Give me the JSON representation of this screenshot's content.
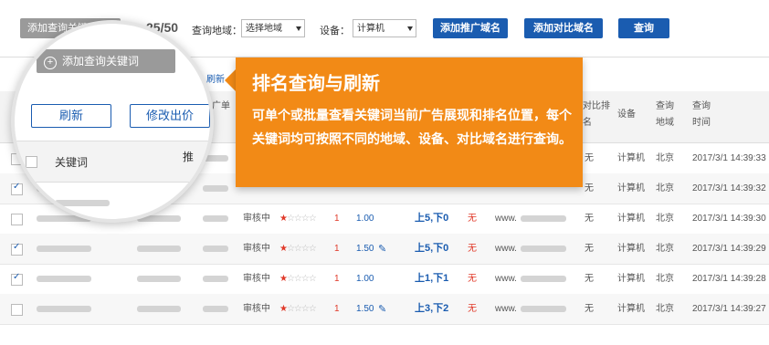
{
  "toolbar": {
    "add_keyword_label": "添加查询关键词",
    "counter": "25/50",
    "region_label": "查询地域：",
    "region_value": "选择地域",
    "device_label": "设备：",
    "device_value": "计算机",
    "add_promo_domain": "添加推广域名",
    "add_compare_domain": "添加对比域名",
    "query_button": "查询"
  },
  "magnifier": {
    "add_keyword_label": "添加查询关键词",
    "refresh_button": "刷新",
    "modify_bid_button": "修改出价",
    "col_keyword": "关键词",
    "col_promo": "推",
    "partial_button": "刷新"
  },
  "callout": {
    "title": "排名查询与刷新",
    "text": "可单个或批量查看关键词当前广告展现和排名位置，每个关键词均可按照不同的地域、设备、对比域名进行查询。"
  },
  "table": {
    "headers": {
      "promo_unit": "推广单元",
      "compare_rank": "对比排名",
      "device": "设备",
      "query_region": "查询地域",
      "query_time": "查询时间"
    },
    "rows": [
      {
        "checked": false,
        "status": "",
        "bid": "",
        "rank": "",
        "red": "",
        "domain": "",
        "compare": "无",
        "device": "计算机",
        "region": "北京",
        "time": "2017/3/1 14:39:33",
        "stars": 0
      },
      {
        "checked": true,
        "status": "",
        "bid": "",
        "rank": "",
        "red": "",
        "domain": "",
        "compare": "无",
        "device": "计算机",
        "region": "北京",
        "time": "2017/3/1 14:39:32",
        "stars": 0
      },
      {
        "checked": false,
        "status": "审核中",
        "bid": "1.00",
        "rank": "上5,下0",
        "red": "无",
        "domain": "www.",
        "compare": "无",
        "device": "计算机",
        "region": "北京",
        "time": "2017/3/1 14:39:30",
        "stars": 1
      },
      {
        "checked": true,
        "status": "审核中",
        "bid": "1.50",
        "rank": "上5,下0",
        "red": "无",
        "domain": "www.",
        "compare": "无",
        "device": "计算机",
        "region": "北京",
        "time": "2017/3/1 14:39:29",
        "stars": 1
      },
      {
        "checked": true,
        "status": "审核中",
        "bid": "1.00",
        "rank": "上1,下1",
        "red": "无",
        "domain": "www.",
        "compare": "无",
        "device": "计算机",
        "region": "北京",
        "time": "2017/3/1 14:39:28",
        "stars": 1
      },
      {
        "checked": false,
        "status": "审核中",
        "bid": "1.50",
        "rank": "上3,下2",
        "red": "无",
        "domain": "www.",
        "compare": "无",
        "device": "计算机",
        "region": "北京",
        "time": "2017/3/1 14:39:27",
        "stars": 1
      }
    ],
    "star_count_label": "1"
  },
  "colors": {
    "accent": "#1a5cb0",
    "callout": "#f28a16",
    "danger": "#e03a2a"
  }
}
